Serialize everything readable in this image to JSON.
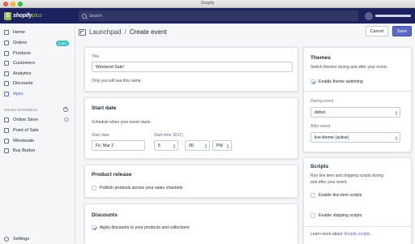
{
  "window": {
    "title": "Shopify"
  },
  "topbar": {
    "logo_text": "shopify",
    "logo_suffix": "plus",
    "search_placeholder": "Search"
  },
  "sidebar": {
    "items": [
      {
        "label": "Home",
        "icon": "home-icon"
      },
      {
        "label": "Orders",
        "icon": "orders-icon",
        "badge": "6,583"
      },
      {
        "label": "Products",
        "icon": "products-icon"
      },
      {
        "label": "Customers",
        "icon": "customers-icon"
      },
      {
        "label": "Analytics",
        "icon": "analytics-icon"
      },
      {
        "label": "Discounts",
        "icon": "discounts-icon"
      },
      {
        "label": "Apps",
        "icon": "apps-icon",
        "active": true
      }
    ],
    "channels_label": "SALES CHANNELS",
    "channels": [
      {
        "label": "Online Store",
        "icon": "online-store-icon"
      },
      {
        "label": "Point of Sale",
        "icon": "pos-icon"
      },
      {
        "label": "Wholesale",
        "icon": "wholesale-icon"
      },
      {
        "label": "Buy Button",
        "icon": "buy-button-icon"
      }
    ],
    "settings_label": "Settings"
  },
  "header": {
    "breadcrumb_link": "Launchpad",
    "separator": "/",
    "title": "Create event",
    "cancel_label": "Cancel",
    "save_label": "Save"
  },
  "title_card": {
    "label": "Title",
    "value": "Weekend Sale!",
    "help": "Only you will see this name."
  },
  "start_date_card": {
    "title": "Start date",
    "description": "Schedule when your event starts.",
    "date_label": "Start date",
    "date_value": "Fri, Mar 2",
    "time_label": "Start time (EST)",
    "hour": "5",
    "minute": "00",
    "ampm": "PM"
  },
  "product_release_card": {
    "title": "Product release",
    "checkbox_label": "Publish products across your sales channels",
    "checked": false
  },
  "discounts_card": {
    "title": "Discounts",
    "checkbox_label": "Apply discounts to your products and collections",
    "checked": true
  },
  "themes_card": {
    "title": "Themes",
    "description": "Switch themes during and after your event.",
    "enable_label": "Enable theme switching",
    "enable_checked": true,
    "during_label": "During event",
    "during_value": "debut",
    "after_label": "After event",
    "after_value": "live-theme (active)"
  },
  "scripts_card": {
    "title": "Scripts",
    "description_line1": "Run line item and shipping scripts during",
    "description_line2": "and after your event.",
    "line_item_label": "Enable line item scripts",
    "shipping_label": "Enable shipping scripts",
    "learn_prefix": "Learn more about ",
    "learn_link": "Shopify scripts."
  },
  "colors": {
    "topbar": "#1c2260",
    "accent": "#5c6ac4",
    "badge": "#47c1bf",
    "logo_green": "#95bf47"
  }
}
